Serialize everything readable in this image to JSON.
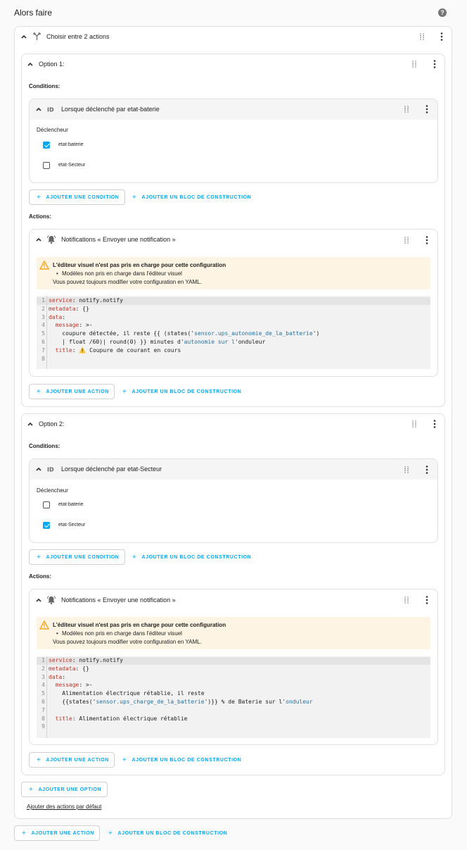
{
  "page": {
    "title": "Alors faire"
  },
  "choose": {
    "title": "Choisir entre 2 actions",
    "add_option": "AJOUTER UNE OPTION",
    "default_link": "Ajouter des actions par défaut"
  },
  "options": [
    {
      "title": "Option 1:",
      "conditions_label": "Conditions:",
      "condition": {
        "title": "Lorsque déclenché par etat-baterie",
        "trigger_label": "Déclencheur",
        "checkboxes": [
          {
            "label": "etat-baterie",
            "checked": true
          },
          {
            "label": "etat-Secteur",
            "checked": false
          }
        ]
      },
      "add_condition": "AJOUTER UNE CONDITION",
      "add_block_condition": "AJOUTER UN BLOC DE CONSTRUCTION",
      "actions_label": "Actions:",
      "action": {
        "title": "Notifications « Envoyer une notification »",
        "warning_title": "L'éditeur visuel n'est pas pris en charge pour cette configuration",
        "warning_bullet": "Modèles non pris en charge dans l'éditeur visuel",
        "warning_note": "Vous pouvez toujours modifier votre configuration en YAML.",
        "code_lines": [
          {
            "n": "1",
            "k": "service",
            "rest": ": notify.notify"
          },
          {
            "n": "2",
            "k": "metadata",
            "rest": ": {}"
          },
          {
            "n": "3",
            "k": "data",
            "rest": ":"
          },
          {
            "n": "4",
            "k": "  message",
            "rest": ": >-"
          },
          {
            "n": "5",
            "k": "",
            "rest": "    coupure détectée, il reste {{ (states('",
            "s": "sensor.ups_autonomie_de_la_batterie",
            "rest2": "')"
          },
          {
            "n": "6",
            "k": "",
            "rest": "    | float /60)| round(0) }} minutes d'",
            "s": "autonomie sur l",
            "rest2": "'onduleur"
          },
          {
            "n": "7",
            "k": "  title",
            "rest": ": ⚠️ Coupure de courant en cours"
          },
          {
            "n": "8",
            "k": "",
            "rest": ""
          }
        ]
      },
      "add_action": "AJOUTER UNE ACTION",
      "add_block_action": "AJOUTER UN BLOC DE CONSTRUCTION"
    },
    {
      "title": "Option 2:",
      "conditions_label": "Conditions:",
      "condition": {
        "title": "Lorsque déclenché par etat-Secteur",
        "trigger_label": "Déclencheur",
        "checkboxes": [
          {
            "label": "etat-baterie",
            "checked": false
          },
          {
            "label": "etat-Secteur",
            "checked": true
          }
        ]
      },
      "add_condition": "AJOUTER UNE CONDITION",
      "add_block_condition": "AJOUTER UN BLOC DE CONSTRUCTION",
      "actions_label": "Actions:",
      "action": {
        "title": "Notifications « Envoyer une notification »",
        "warning_title": "L'éditeur visuel n'est pas pris en charge pour cette configuration",
        "warning_bullet": "Modèles non pris en charge dans l'éditeur visuel",
        "warning_note": "Vous pouvez toujours modifier votre configuration en YAML.",
        "code_lines": [
          {
            "n": "1",
            "k": "service",
            "rest": ": notify.notify"
          },
          {
            "n": "2",
            "k": "metadata",
            "rest": ": {}"
          },
          {
            "n": "3",
            "k": "data",
            "rest": ":"
          },
          {
            "n": "4",
            "k": "  message",
            "rest": ": >-"
          },
          {
            "n": "5",
            "k": "",
            "rest": "    Alimentation électrique rétablie, il reste"
          },
          {
            "n": "6",
            "k": "",
            "rest": "    {{states('",
            "s": "sensor.ups_charge_de_la_batterie",
            "rest2": "')}} % de Baterie sur l'",
            "s2": "onduleur"
          },
          {
            "n": "7",
            "k": "",
            "rest": ""
          },
          {
            "n": "8",
            "k": "  title",
            "rest": ": Alimentation électrique rétablie"
          },
          {
            "n": "9",
            "k": "",
            "rest": ""
          }
        ]
      },
      "add_action": "AJOUTER UNE ACTION",
      "add_block_action": "AJOUTER UN BLOC DE CONSTRUCTION"
    }
  ],
  "footer": {
    "add_action": "AJOUTER UNE ACTION",
    "add_block": "AJOUTER UN BLOC DE CONSTRUCTION"
  },
  "colors": {
    "accent": "#03a9f4",
    "warning": "#f9a825",
    "warning_bg": "#fdf4e3",
    "code_bg": "#f2f2f2"
  },
  "icons": [
    "help-icon",
    "chevron-up-icon",
    "choose-icon",
    "drag-handle-icon",
    "more-vert-icon",
    "trigger-condition-icon",
    "bell-icon",
    "warning-icon",
    "checkbox-icon",
    "plus-icon"
  ]
}
